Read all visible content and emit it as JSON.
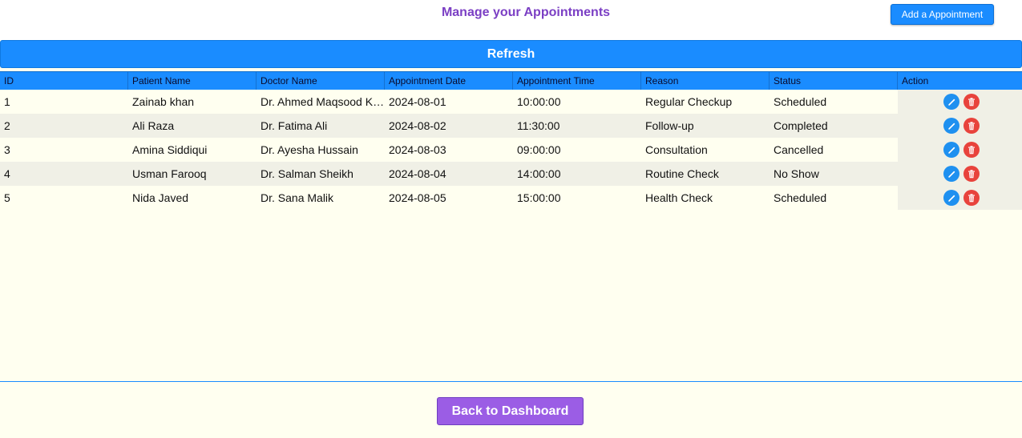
{
  "header": {
    "title": "Manage your Appointments",
    "add_button_label": "Add a Appointment"
  },
  "refresh_label": "Refresh",
  "table": {
    "columns": [
      "ID",
      "Patient Name",
      "Doctor Name",
      "Appointment Date",
      "Appointment Time",
      "Reason",
      "Status",
      "Action"
    ],
    "rows": [
      {
        "id": "1",
        "patient": "Zainab khan",
        "doctor": "Dr. Ahmed Maqsood Khan",
        "date": "2024-08-01",
        "time": "10:00:00",
        "reason": "Regular Checkup",
        "status": "Scheduled"
      },
      {
        "id": "2",
        "patient": "Ali Raza",
        "doctor": "Dr. Fatima Ali",
        "date": "2024-08-02",
        "time": "11:30:00",
        "reason": "Follow-up",
        "status": "Completed"
      },
      {
        "id": "3",
        "patient": "Amina Siddiqui",
        "doctor": "Dr. Ayesha Hussain",
        "date": "2024-08-03",
        "time": "09:00:00",
        "reason": "Consultation",
        "status": "Cancelled"
      },
      {
        "id": "4",
        "patient": "Usman Farooq",
        "doctor": "Dr. Salman Sheikh",
        "date": "2024-08-04",
        "time": "14:00:00",
        "reason": "Routine Check",
        "status": "No Show"
      },
      {
        "id": "5",
        "patient": "Nida Javed",
        "doctor": "Dr. Sana Malik",
        "date": "2024-08-05",
        "time": "15:00:00",
        "reason": "Health Check",
        "status": "Scheduled"
      }
    ],
    "row_actions": [
      "pencil-icon",
      "trash-icon"
    ]
  },
  "footer": {
    "back_button_label": "Back to Dashboard"
  },
  "colors": {
    "accent": "#1a8cff",
    "title": "#7b3fc4",
    "back_button": "#9b5de5",
    "edit": "#1e90f0",
    "delete": "#e8433c",
    "background": "#fffff0"
  }
}
